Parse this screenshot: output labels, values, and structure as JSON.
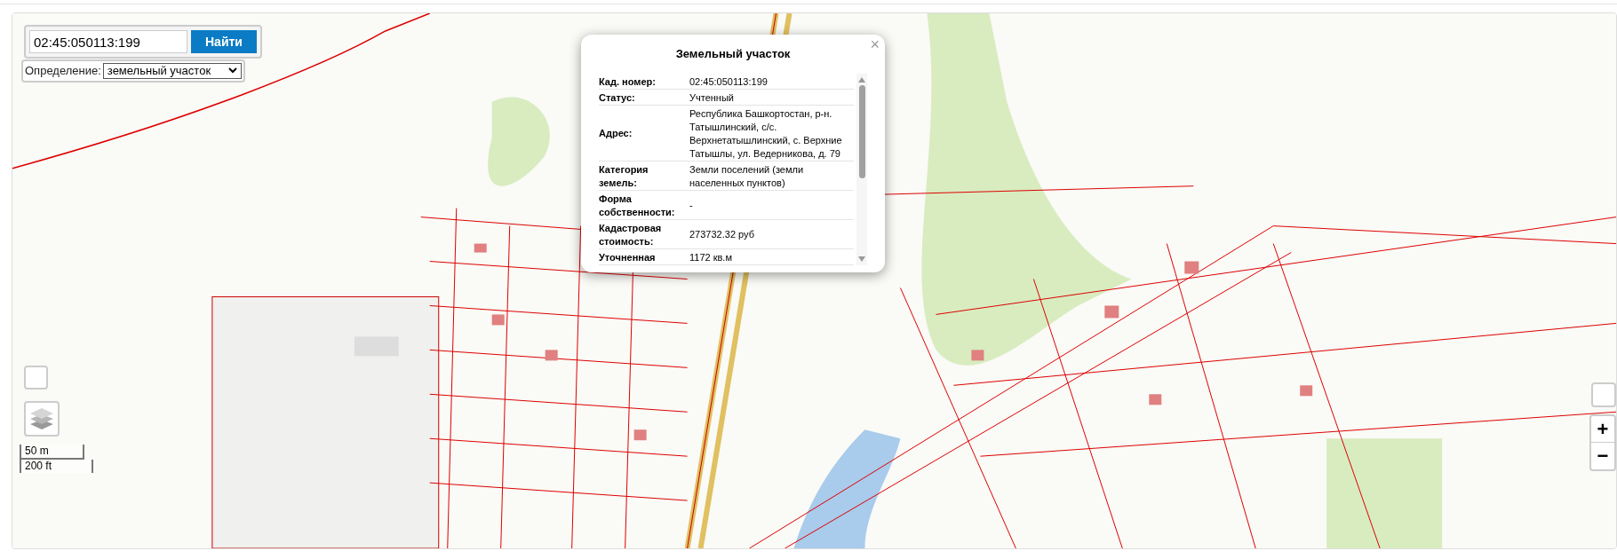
{
  "search": {
    "value": "02:45:050113:199",
    "button": "Найти"
  },
  "definition": {
    "label": "Определение:",
    "value": "земельный участок"
  },
  "popup": {
    "title": "Земельный участок",
    "close": "×",
    "rows": [
      {
        "label": "Кад. номер:",
        "value": "02:45:050113:199"
      },
      {
        "label": "Статус:",
        "value": "Учтенный"
      },
      {
        "label": "Адрес:",
        "value": "Республика Башкортостан, р-н. Татышлинский, с/с. Верхнетатышлинский, с. Верхние Татышлы, ул. Ведерникова, д. 79"
      },
      {
        "label": "Категория земель:",
        "value": "Земли поселений (земли населенных пунктов)"
      },
      {
        "label": "Форма собственности:",
        "value": "-"
      },
      {
        "label": "Кадастровая стоимость:",
        "value": "273732.32 руб"
      },
      {
        "label": "Уточненная",
        "value": "1172 кв.м"
      }
    ]
  },
  "scale": {
    "metric": "50 m",
    "imperial": "200 ft"
  },
  "zoom": {
    "in": "+",
    "out": "−"
  }
}
